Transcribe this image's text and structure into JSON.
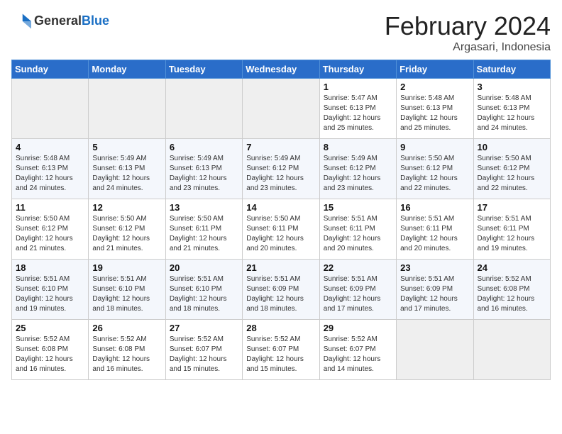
{
  "header": {
    "logo_general": "General",
    "logo_blue": "Blue",
    "title": "February 2024",
    "subtitle": "Argasari, Indonesia"
  },
  "weekdays": [
    "Sunday",
    "Monday",
    "Tuesday",
    "Wednesday",
    "Thursday",
    "Friday",
    "Saturday"
  ],
  "weeks": [
    [
      {
        "day": "",
        "empty": true
      },
      {
        "day": "",
        "empty": true
      },
      {
        "day": "",
        "empty": true
      },
      {
        "day": "",
        "empty": true
      },
      {
        "day": "1",
        "sunrise": "5:47 AM",
        "sunset": "6:13 PM",
        "daylight": "12 hours and 25 minutes."
      },
      {
        "day": "2",
        "sunrise": "5:48 AM",
        "sunset": "6:13 PM",
        "daylight": "12 hours and 25 minutes."
      },
      {
        "day": "3",
        "sunrise": "5:48 AM",
        "sunset": "6:13 PM",
        "daylight": "12 hours and 24 minutes."
      }
    ],
    [
      {
        "day": "4",
        "sunrise": "5:48 AM",
        "sunset": "6:13 PM",
        "daylight": "12 hours and 24 minutes."
      },
      {
        "day": "5",
        "sunrise": "5:49 AM",
        "sunset": "6:13 PM",
        "daylight": "12 hours and 24 minutes."
      },
      {
        "day": "6",
        "sunrise": "5:49 AM",
        "sunset": "6:13 PM",
        "daylight": "12 hours and 23 minutes."
      },
      {
        "day": "7",
        "sunrise": "5:49 AM",
        "sunset": "6:12 PM",
        "daylight": "12 hours and 23 minutes."
      },
      {
        "day": "8",
        "sunrise": "5:49 AM",
        "sunset": "6:12 PM",
        "daylight": "12 hours and 23 minutes."
      },
      {
        "day": "9",
        "sunrise": "5:50 AM",
        "sunset": "6:12 PM",
        "daylight": "12 hours and 22 minutes."
      },
      {
        "day": "10",
        "sunrise": "5:50 AM",
        "sunset": "6:12 PM",
        "daylight": "12 hours and 22 minutes."
      }
    ],
    [
      {
        "day": "11",
        "sunrise": "5:50 AM",
        "sunset": "6:12 PM",
        "daylight": "12 hours and 21 minutes."
      },
      {
        "day": "12",
        "sunrise": "5:50 AM",
        "sunset": "6:12 PM",
        "daylight": "12 hours and 21 minutes."
      },
      {
        "day": "13",
        "sunrise": "5:50 AM",
        "sunset": "6:11 PM",
        "daylight": "12 hours and 21 minutes."
      },
      {
        "day": "14",
        "sunrise": "5:50 AM",
        "sunset": "6:11 PM",
        "daylight": "12 hours and 20 minutes."
      },
      {
        "day": "15",
        "sunrise": "5:51 AM",
        "sunset": "6:11 PM",
        "daylight": "12 hours and 20 minutes."
      },
      {
        "day": "16",
        "sunrise": "5:51 AM",
        "sunset": "6:11 PM",
        "daylight": "12 hours and 20 minutes."
      },
      {
        "day": "17",
        "sunrise": "5:51 AM",
        "sunset": "6:11 PM",
        "daylight": "12 hours and 19 minutes."
      }
    ],
    [
      {
        "day": "18",
        "sunrise": "5:51 AM",
        "sunset": "6:10 PM",
        "daylight": "12 hours and 19 minutes."
      },
      {
        "day": "19",
        "sunrise": "5:51 AM",
        "sunset": "6:10 PM",
        "daylight": "12 hours and 18 minutes."
      },
      {
        "day": "20",
        "sunrise": "5:51 AM",
        "sunset": "6:10 PM",
        "daylight": "12 hours and 18 minutes."
      },
      {
        "day": "21",
        "sunrise": "5:51 AM",
        "sunset": "6:09 PM",
        "daylight": "12 hours and 18 minutes."
      },
      {
        "day": "22",
        "sunrise": "5:51 AM",
        "sunset": "6:09 PM",
        "daylight": "12 hours and 17 minutes."
      },
      {
        "day": "23",
        "sunrise": "5:51 AM",
        "sunset": "6:09 PM",
        "daylight": "12 hours and 17 minutes."
      },
      {
        "day": "24",
        "sunrise": "5:52 AM",
        "sunset": "6:08 PM",
        "daylight": "12 hours and 16 minutes."
      }
    ],
    [
      {
        "day": "25",
        "sunrise": "5:52 AM",
        "sunset": "6:08 PM",
        "daylight": "12 hours and 16 minutes."
      },
      {
        "day": "26",
        "sunrise": "5:52 AM",
        "sunset": "6:08 PM",
        "daylight": "12 hours and 16 minutes."
      },
      {
        "day": "27",
        "sunrise": "5:52 AM",
        "sunset": "6:07 PM",
        "daylight": "12 hours and 15 minutes."
      },
      {
        "day": "28",
        "sunrise": "5:52 AM",
        "sunset": "6:07 PM",
        "daylight": "12 hours and 15 minutes."
      },
      {
        "day": "29",
        "sunrise": "5:52 AM",
        "sunset": "6:07 PM",
        "daylight": "12 hours and 14 minutes."
      },
      {
        "day": "",
        "empty": true
      },
      {
        "day": "",
        "empty": true
      }
    ]
  ],
  "labels": {
    "sunrise": "Sunrise:",
    "sunset": "Sunset:",
    "daylight": "Daylight:"
  }
}
